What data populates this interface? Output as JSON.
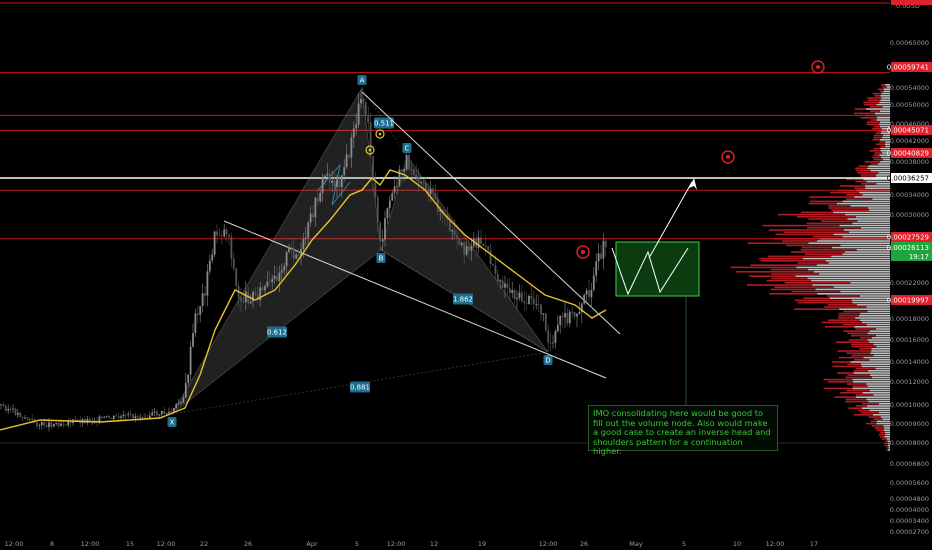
{
  "chart_data": {
    "type": "candlestick",
    "currency_label": "USD",
    "top_value_label": "0.0",
    "price_axis": {
      "ticks": [
        "0.00065000",
        "0.00054000",
        "0.00050000",
        "0.00046000",
        "0.00042000",
        "0.00038000",
        "0.00034000",
        "0.00030000",
        "0.00026000",
        "0.00022000",
        "0.00018000",
        "0.00016000",
        "0.00014000",
        "0.00012000",
        "0.00010000",
        "0.00009000",
        "0.00008000",
        "0.00006800",
        "0.00005600",
        "0.00004800",
        "0.00004000",
        "0.00003400",
        "0.00002700"
      ],
      "tick_values": [
        0.00065,
        0.00054,
        0.0005,
        0.00046,
        0.00042,
        0.00038,
        0.00034,
        0.0003,
        0.00026,
        0.00022,
        0.00018,
        0.00016,
        0.00014,
        0.00012,
        0.0001,
        9e-05,
        8e-05,
        6.8e-05,
        5.6e-05,
        4.8e-05,
        4e-05,
        3.4e-05,
        2.7e-05
      ],
      "scale": "log"
    },
    "price_labels": [
      {
        "text": "0.00059741",
        "value": 0.00059741,
        "color": "#e0202a",
        "style": "solid"
      },
      {
        "text": "0.00045071",
        "value": 0.00045071,
        "color": "#e0202a",
        "style": "solid"
      },
      {
        "text": "0.00040829",
        "value": 0.00040829,
        "color": "#e0202a",
        "style": "solid"
      },
      {
        "text": "0.00036257",
        "value": 0.00036257,
        "color": "#ffffff",
        "style": "white"
      },
      {
        "text": "0.00027529",
        "value": 0.00027529,
        "color": "#e0202a",
        "style": "solid"
      },
      {
        "text": "0.00019997",
        "value": 0.00019997,
        "color": "#e0202a",
        "style": "solid"
      }
    ],
    "current_price": {
      "text": "0.00026113",
      "countdown": "19:17",
      "value": 0.00026113,
      "color": "#1ea63c"
    },
    "time_axis": {
      "labels": [
        "12:00",
        "8",
        "12:00",
        "15",
        "12:00",
        "22",
        "26",
        "Apr",
        "5",
        "12:00",
        "12",
        "19",
        "12:00",
        "26",
        "May",
        "5",
        "10",
        "12:00",
        "17"
      ]
    },
    "pattern_points": [
      {
        "label": "X",
        "value": 0.0001
      },
      {
        "label": "A",
        "value": 0.00056
      },
      {
        "label": "B",
        "value": 0.00026
      },
      {
        "label": "C",
        "value": 0.00043
      },
      {
        "label": "D",
        "value": 0.000148
      }
    ],
    "ratios": [
      "0.511",
      "0.612",
      "1.862",
      "0.881"
    ],
    "ma_color": "#e8c22e",
    "candle_up_color": "#7a7a7a",
    "candle_down_color": "#4a4a4a",
    "annotation": "IMO consolidating here would be good to fill out the volume node. Also would make a good case to create an inverse head and shoulders pattern for a continuation higher.",
    "grid": false
  }
}
